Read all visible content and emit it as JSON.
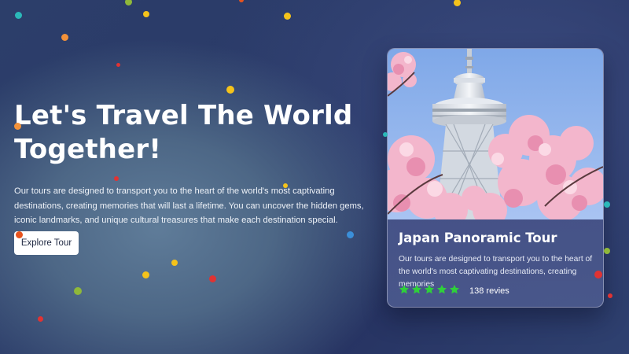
{
  "hero": {
    "title": "Let's Travel The World Together!",
    "description": "Our tours are designed to transport you to the heart of the world's most captivating destinations, creating memories that will last a lifetime. You can uncover the hidden gems, iconic landmarks, and unique cultural treasures that make each destination special.",
    "cta_label": "Explore Tour"
  },
  "card": {
    "image_icon": "tokyo-skytree-cherry-blossom-photo",
    "title": "Japan Panoramic Tour",
    "description": "Our tours are designed to transport you to the heart of the world's most captivating destinations, creating memories",
    "rating": 5,
    "rating_max": 5,
    "reviews_text": "138 revies"
  },
  "colors": {
    "star": "#2fd03b",
    "cta_background": "#ffffff",
    "confetti": [
      "#f5c31b",
      "#f4923a",
      "#e03333",
      "#3b8fd9",
      "#8fb83a",
      "#2bb8b8",
      "#e8531d"
    ]
  },
  "icons": {
    "star": "star-icon"
  }
}
